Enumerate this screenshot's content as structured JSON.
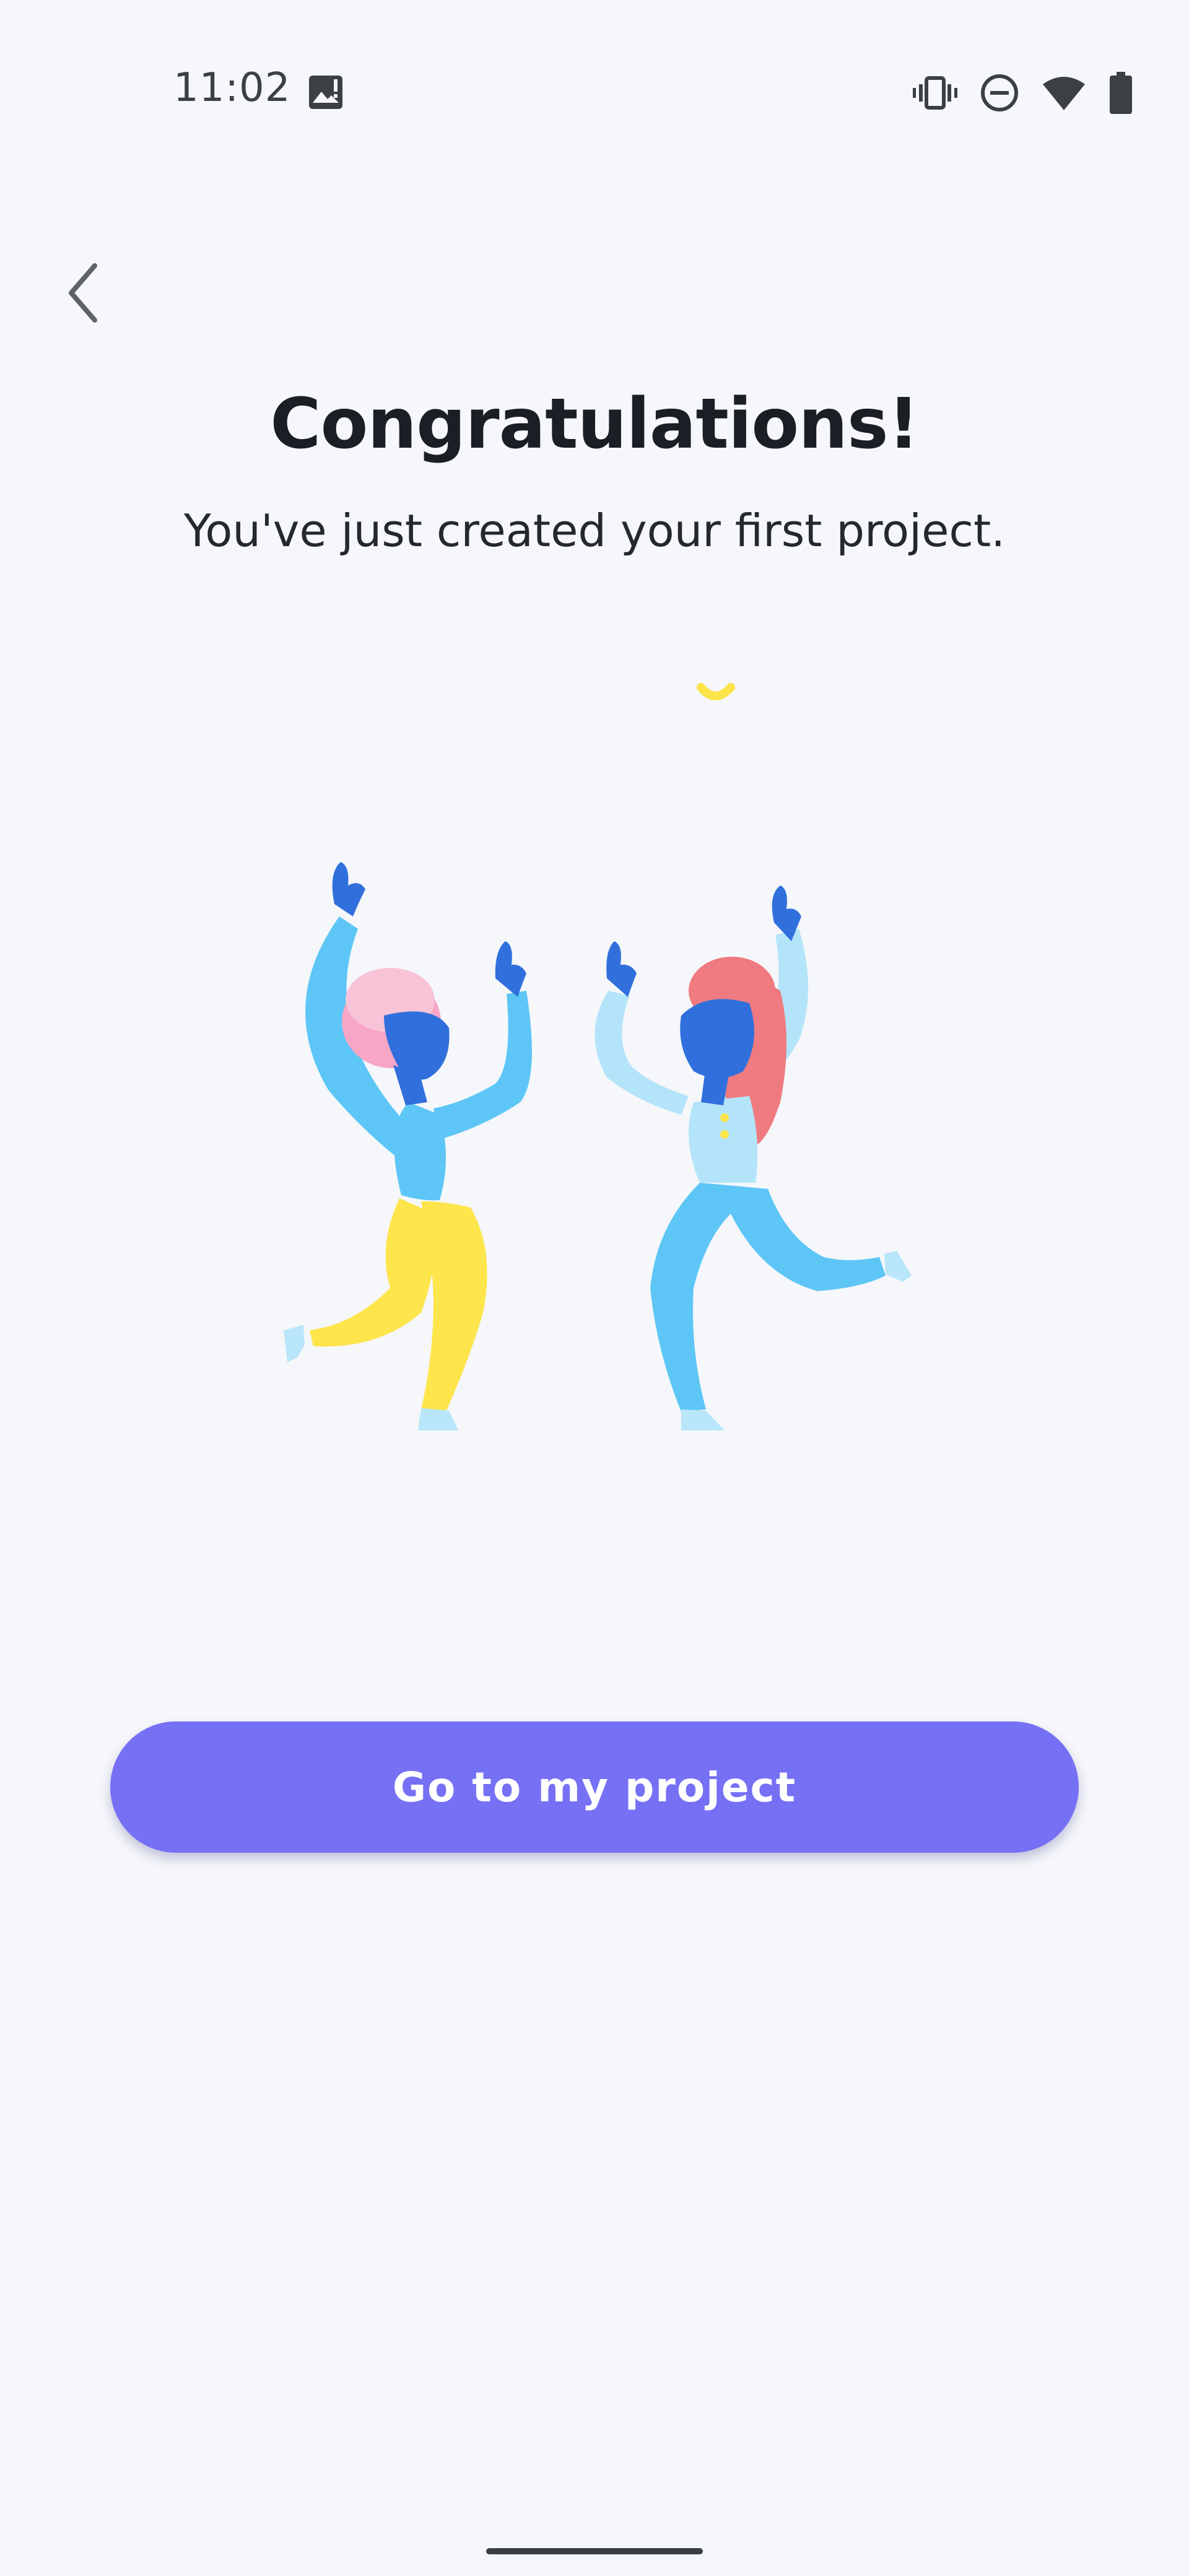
{
  "status_bar": {
    "time": "11:02",
    "icons": [
      "gallery-notification-icon",
      "vibrate-icon",
      "do-not-disturb-icon",
      "wifi-icon",
      "battery-icon"
    ]
  },
  "nav": {
    "back_icon": "chevron-left-icon"
  },
  "header": {
    "title": "Congratulations!",
    "subtitle": "You've just created your first project."
  },
  "illustration": {
    "description_icon": "celebrating-people-illustration"
  },
  "actions": {
    "primary_label": "Go to my project"
  },
  "colors": {
    "background": "#f5f7fa",
    "accent": "#7670f5",
    "text": "#1b1e24"
  }
}
